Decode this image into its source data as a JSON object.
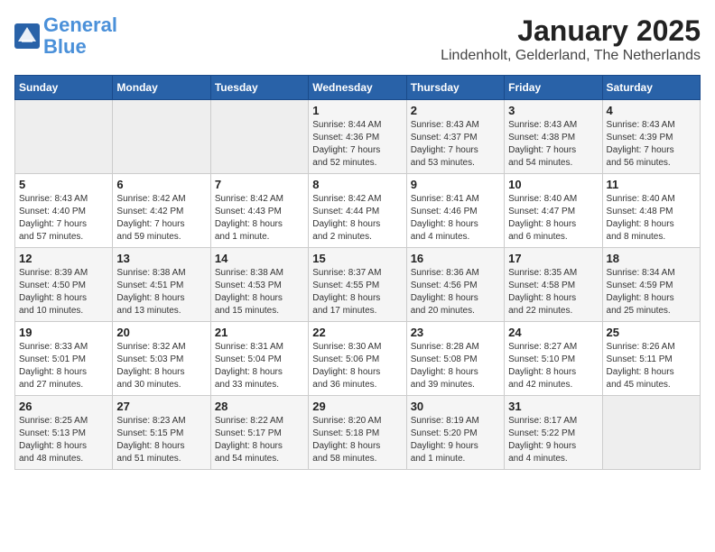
{
  "header": {
    "logo_line1": "General",
    "logo_line2": "Blue",
    "title": "January 2025",
    "subtitle": "Lindenholt, Gelderland, The Netherlands"
  },
  "columns": [
    "Sunday",
    "Monday",
    "Tuesday",
    "Wednesday",
    "Thursday",
    "Friday",
    "Saturday"
  ],
  "weeks": [
    [
      {
        "day": "",
        "info": ""
      },
      {
        "day": "",
        "info": ""
      },
      {
        "day": "",
        "info": ""
      },
      {
        "day": "1",
        "info": "Sunrise: 8:44 AM\nSunset: 4:36 PM\nDaylight: 7 hours\nand 52 minutes."
      },
      {
        "day": "2",
        "info": "Sunrise: 8:43 AM\nSunset: 4:37 PM\nDaylight: 7 hours\nand 53 minutes."
      },
      {
        "day": "3",
        "info": "Sunrise: 8:43 AM\nSunset: 4:38 PM\nDaylight: 7 hours\nand 54 minutes."
      },
      {
        "day": "4",
        "info": "Sunrise: 8:43 AM\nSunset: 4:39 PM\nDaylight: 7 hours\nand 56 minutes."
      }
    ],
    [
      {
        "day": "5",
        "info": "Sunrise: 8:43 AM\nSunset: 4:40 PM\nDaylight: 7 hours\nand 57 minutes."
      },
      {
        "day": "6",
        "info": "Sunrise: 8:42 AM\nSunset: 4:42 PM\nDaylight: 7 hours\nand 59 minutes."
      },
      {
        "day": "7",
        "info": "Sunrise: 8:42 AM\nSunset: 4:43 PM\nDaylight: 8 hours\nand 1 minute."
      },
      {
        "day": "8",
        "info": "Sunrise: 8:42 AM\nSunset: 4:44 PM\nDaylight: 8 hours\nand 2 minutes."
      },
      {
        "day": "9",
        "info": "Sunrise: 8:41 AM\nSunset: 4:46 PM\nDaylight: 8 hours\nand 4 minutes."
      },
      {
        "day": "10",
        "info": "Sunrise: 8:40 AM\nSunset: 4:47 PM\nDaylight: 8 hours\nand 6 minutes."
      },
      {
        "day": "11",
        "info": "Sunrise: 8:40 AM\nSunset: 4:48 PM\nDaylight: 8 hours\nand 8 minutes."
      }
    ],
    [
      {
        "day": "12",
        "info": "Sunrise: 8:39 AM\nSunset: 4:50 PM\nDaylight: 8 hours\nand 10 minutes."
      },
      {
        "day": "13",
        "info": "Sunrise: 8:38 AM\nSunset: 4:51 PM\nDaylight: 8 hours\nand 13 minutes."
      },
      {
        "day": "14",
        "info": "Sunrise: 8:38 AM\nSunset: 4:53 PM\nDaylight: 8 hours\nand 15 minutes."
      },
      {
        "day": "15",
        "info": "Sunrise: 8:37 AM\nSunset: 4:55 PM\nDaylight: 8 hours\nand 17 minutes."
      },
      {
        "day": "16",
        "info": "Sunrise: 8:36 AM\nSunset: 4:56 PM\nDaylight: 8 hours\nand 20 minutes."
      },
      {
        "day": "17",
        "info": "Sunrise: 8:35 AM\nSunset: 4:58 PM\nDaylight: 8 hours\nand 22 minutes."
      },
      {
        "day": "18",
        "info": "Sunrise: 8:34 AM\nSunset: 4:59 PM\nDaylight: 8 hours\nand 25 minutes."
      }
    ],
    [
      {
        "day": "19",
        "info": "Sunrise: 8:33 AM\nSunset: 5:01 PM\nDaylight: 8 hours\nand 27 minutes."
      },
      {
        "day": "20",
        "info": "Sunrise: 8:32 AM\nSunset: 5:03 PM\nDaylight: 8 hours\nand 30 minutes."
      },
      {
        "day": "21",
        "info": "Sunrise: 8:31 AM\nSunset: 5:04 PM\nDaylight: 8 hours\nand 33 minutes."
      },
      {
        "day": "22",
        "info": "Sunrise: 8:30 AM\nSunset: 5:06 PM\nDaylight: 8 hours\nand 36 minutes."
      },
      {
        "day": "23",
        "info": "Sunrise: 8:28 AM\nSunset: 5:08 PM\nDaylight: 8 hours\nand 39 minutes."
      },
      {
        "day": "24",
        "info": "Sunrise: 8:27 AM\nSunset: 5:10 PM\nDaylight: 8 hours\nand 42 minutes."
      },
      {
        "day": "25",
        "info": "Sunrise: 8:26 AM\nSunset: 5:11 PM\nDaylight: 8 hours\nand 45 minutes."
      }
    ],
    [
      {
        "day": "26",
        "info": "Sunrise: 8:25 AM\nSunset: 5:13 PM\nDaylight: 8 hours\nand 48 minutes."
      },
      {
        "day": "27",
        "info": "Sunrise: 8:23 AM\nSunset: 5:15 PM\nDaylight: 8 hours\nand 51 minutes."
      },
      {
        "day": "28",
        "info": "Sunrise: 8:22 AM\nSunset: 5:17 PM\nDaylight: 8 hours\nand 54 minutes."
      },
      {
        "day": "29",
        "info": "Sunrise: 8:20 AM\nSunset: 5:18 PM\nDaylight: 8 hours\nand 58 minutes."
      },
      {
        "day": "30",
        "info": "Sunrise: 8:19 AM\nSunset: 5:20 PM\nDaylight: 9 hours\nand 1 minute."
      },
      {
        "day": "31",
        "info": "Sunrise: 8:17 AM\nSunset: 5:22 PM\nDaylight: 9 hours\nand 4 minutes."
      },
      {
        "day": "",
        "info": ""
      }
    ]
  ]
}
